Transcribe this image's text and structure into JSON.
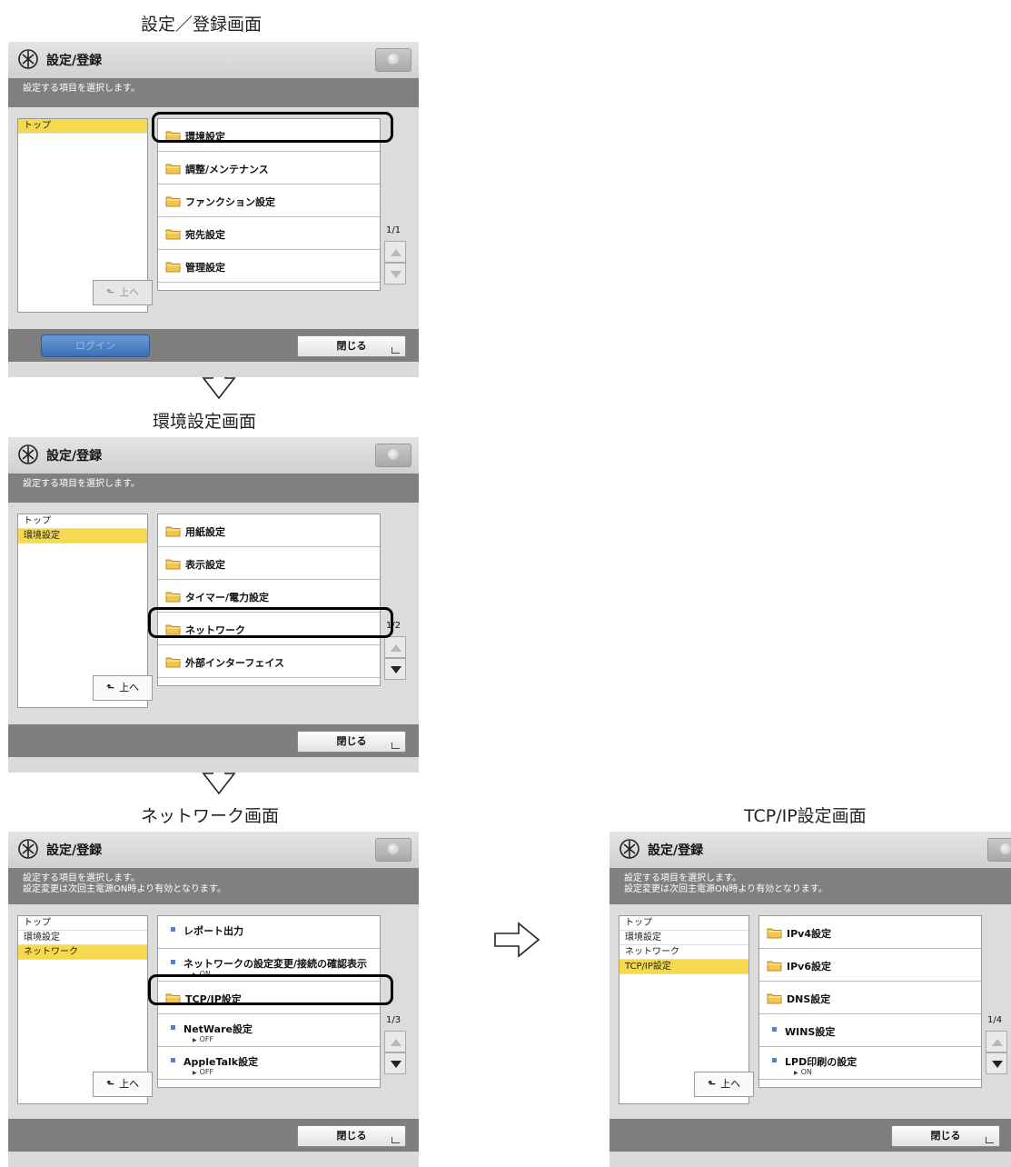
{
  "captions": {
    "c1": "設定／登録画面",
    "c2": "環境設定画面",
    "c3": "ネットワーク画面",
    "c4": "TCP/IP設定画面"
  },
  "common": {
    "title": "設定/登録",
    "msg1": "設定する項目を選択します。",
    "msg2": "設定変更は次回主電源ON時より有効となります。",
    "close_label": "閉じる",
    "up_label": "上へ",
    "up_arrow": "ᵗ",
    "login_label": "ログイン"
  },
  "s1": {
    "crumbs": [
      "トップ"
    ],
    "items": [
      {
        "label": "環境設定"
      },
      {
        "label": "調整/メンテナンス"
      },
      {
        "label": "ファンクション設定"
      },
      {
        "label": "宛先設定"
      },
      {
        "label": "管理設定"
      }
    ],
    "page": "1/1"
  },
  "s2": {
    "crumbs": [
      "トップ",
      "環境設定"
    ],
    "items": [
      {
        "label": "用紙設定"
      },
      {
        "label": "表示設定"
      },
      {
        "label": "タイマー/電力設定"
      },
      {
        "label": "ネットワーク"
      },
      {
        "label": "外部インターフェイス"
      }
    ],
    "page": "1/2"
  },
  "s3": {
    "crumbs": [
      "トップ",
      "環境設定",
      "ネットワーク"
    ],
    "items": [
      {
        "label": "レポート出力",
        "value": ""
      },
      {
        "label": "ネットワークの設定変更/接続の確認表示",
        "value": "ON"
      },
      {
        "label": "TCP/IP設定",
        "value": ""
      },
      {
        "label": "NetWare設定",
        "value": "OFF"
      },
      {
        "label": "AppleTalk設定",
        "value": "OFF"
      }
    ],
    "page": "1/3"
  },
  "s4": {
    "crumbs": [
      "トップ",
      "環境設定",
      "ネットワーク",
      "TCP/IP設定"
    ],
    "items": [
      {
        "label": "IPv4設定"
      },
      {
        "label": "IPv6設定"
      },
      {
        "label": "DNS設定"
      },
      {
        "label": "WINS設定"
      },
      {
        "label": "LPD印刷の設定",
        "value": "ON"
      }
    ],
    "page": "1/4"
  },
  "colors": {
    "selected_crumb": "#f5da50",
    "message_bar": "#808080",
    "highlight_outline": "#000000",
    "login_button": "#4a7fc4"
  },
  "icons": [
    "settings-icon",
    "folder-icon",
    "up-arrow-icon",
    "scroll-up-icon",
    "scroll-down-icon",
    "arrow-down-icon",
    "arrow-right-icon"
  ]
}
